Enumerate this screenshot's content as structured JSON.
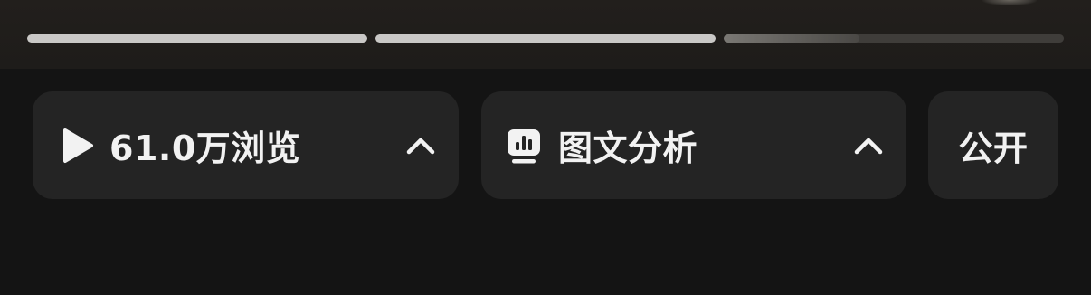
{
  "story_progress": {
    "segments": [
      {
        "fill": 1.0
      },
      {
        "fill": 1.0
      },
      {
        "fill": 0.4
      }
    ]
  },
  "actions": {
    "views": {
      "label": "61.0万浏览",
      "icon": "play-icon",
      "expand_icon": "chevron-up-icon"
    },
    "analysis": {
      "label": "图文分析",
      "icon": "chart-icon",
      "expand_icon": "chevron-up-icon"
    },
    "visibility": {
      "label": "公开"
    }
  },
  "colors": {
    "background": "#141414",
    "top_band": "#211e1c",
    "pill": "#242424",
    "text": "#f2f2f2",
    "progress_track": "#3f3d3a",
    "progress_fill": "#c9c8c6"
  }
}
